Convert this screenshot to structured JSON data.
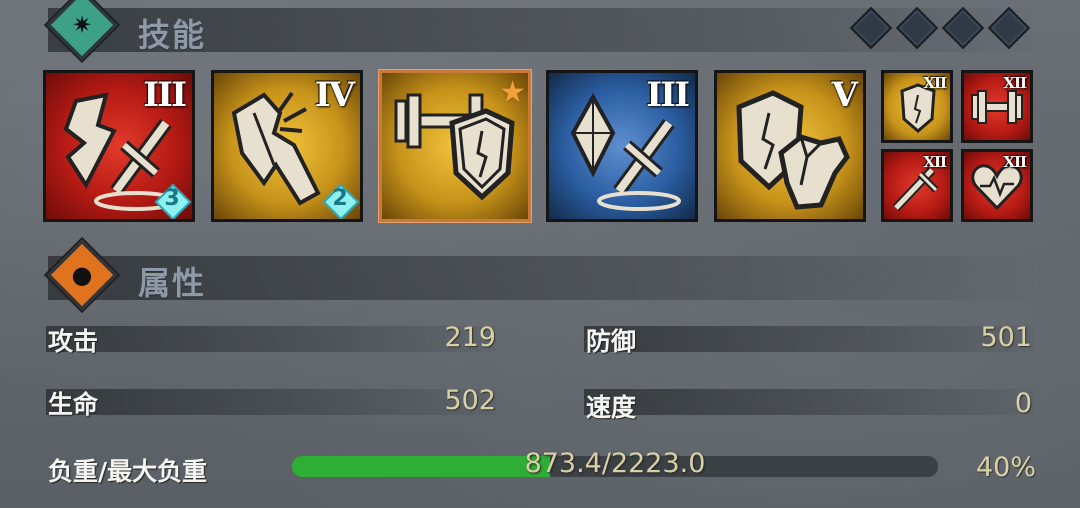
{
  "skills_section": {
    "title": "技能",
    "gems_count": 4
  },
  "skills": [
    {
      "icon": "broken-wall-sword-icon",
      "rank": "III",
      "badge": "3",
      "color": "#c8231b"
    },
    {
      "icon": "shattered-wall-icon",
      "rank": "IV",
      "badge": "2",
      "color": "#d1a21d"
    },
    {
      "icon": "dumbbell-shield-icon",
      "rank": "",
      "badge": "",
      "color": "#d1a21d",
      "selected": true,
      "star": true
    },
    {
      "icon": "crystal-sword-icon",
      "rank": "III",
      "badge": "",
      "color": "#2b5ea2"
    },
    {
      "icon": "shield-armor-icon",
      "rank": "V",
      "badge": "",
      "color": "#d1a21d"
    }
  ],
  "small_skills": [
    {
      "icon": "shield-icon",
      "rank": "XII",
      "color": "#d1a21d"
    },
    {
      "icon": "dumbbell-icon",
      "rank": "XII",
      "color": "#c8231b"
    },
    {
      "icon": "sword-icon",
      "rank": "XII",
      "color": "#c8231b"
    },
    {
      "icon": "heart-icon",
      "rank": "XII",
      "color": "#c8231b"
    }
  ],
  "attributes_section": {
    "title": "属性"
  },
  "stats": {
    "attack": {
      "label": "攻击",
      "value": "219"
    },
    "defense": {
      "label": "防御",
      "value": "501"
    },
    "life": {
      "label": "生命",
      "value": "502"
    },
    "speed": {
      "label": "速度",
      "value": "0"
    }
  },
  "weight": {
    "label": "负重/最大负重",
    "text": "873.4/2223.0",
    "percent_text": "40%",
    "fill_fraction": 0.4,
    "fill_color": "#2fae36"
  },
  "colors": {
    "red_bg": "#c8231b",
    "gold_bg": "#d1a21d",
    "blue_bg": "#2b5ea2",
    "skill_icon_section": "#3da188",
    "attr_icon_section": "#e0731e"
  }
}
